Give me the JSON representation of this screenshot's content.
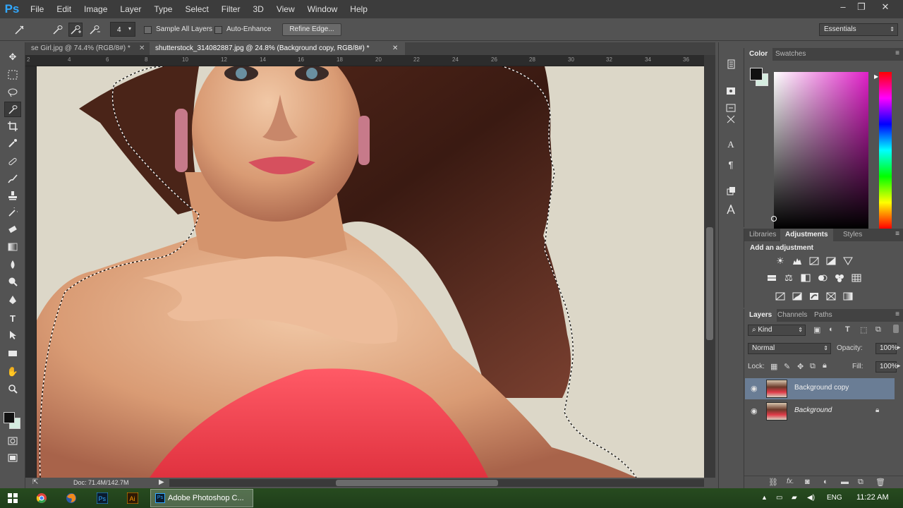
{
  "app": {
    "logo": "Ps",
    "menu": [
      "File",
      "Edit",
      "Image",
      "Layer",
      "Type",
      "Select",
      "Filter",
      "3D",
      "View",
      "Window",
      "Help"
    ],
    "window_controls": [
      "–",
      "❐",
      "✕"
    ]
  },
  "options_bar": {
    "brush_size": "4",
    "sample_all_layers_label": "Sample All Layers",
    "auto_enhance_label": "Auto-Enhance",
    "refine_edge_label": "Refine Edge...",
    "workspace_label": "Essentials"
  },
  "document_tabs": [
    {
      "label": "se Girl.jpg @ 74.4% (RGB/8#) *",
      "active": false
    },
    {
      "label": "shutterstock_314082887.jpg @ 24.8% (Background copy, RGB/8#) *",
      "active": true
    }
  ],
  "ruler_ticks": [
    "2",
    "4",
    "6",
    "8",
    "10",
    "12",
    "14",
    "16",
    "18",
    "20",
    "22",
    "24",
    "26",
    "28",
    "30",
    "32",
    "34",
    "36"
  ],
  "status": {
    "doc_info": "Doc: 71.4M/142.7M"
  },
  "color_panel": {
    "tabs": [
      "Color",
      "Swatches"
    ],
    "foreground": "#111111",
    "background": "#d4ecdf"
  },
  "adjustments_panel": {
    "tabs": [
      "Libraries",
      "Adjustments",
      "Styles"
    ],
    "heading": "Add an adjustment"
  },
  "layers_panel": {
    "tabs": [
      "Layers",
      "Channels",
      "Paths"
    ],
    "filter_kind": "Kind",
    "blend_mode": "Normal",
    "opacity_label": "Opacity:",
    "opacity_value": "100%",
    "lock_label": "Lock:",
    "fill_label": "Fill:",
    "fill_value": "100%",
    "layers": [
      {
        "name": "Background copy",
        "selected": true,
        "locked": false
      },
      {
        "name": "Background",
        "selected": false,
        "locked": true
      }
    ]
  },
  "taskbar": {
    "active_app_label": "Adobe Photoshop C...",
    "language": "ENG",
    "time": "11:22 AM"
  }
}
